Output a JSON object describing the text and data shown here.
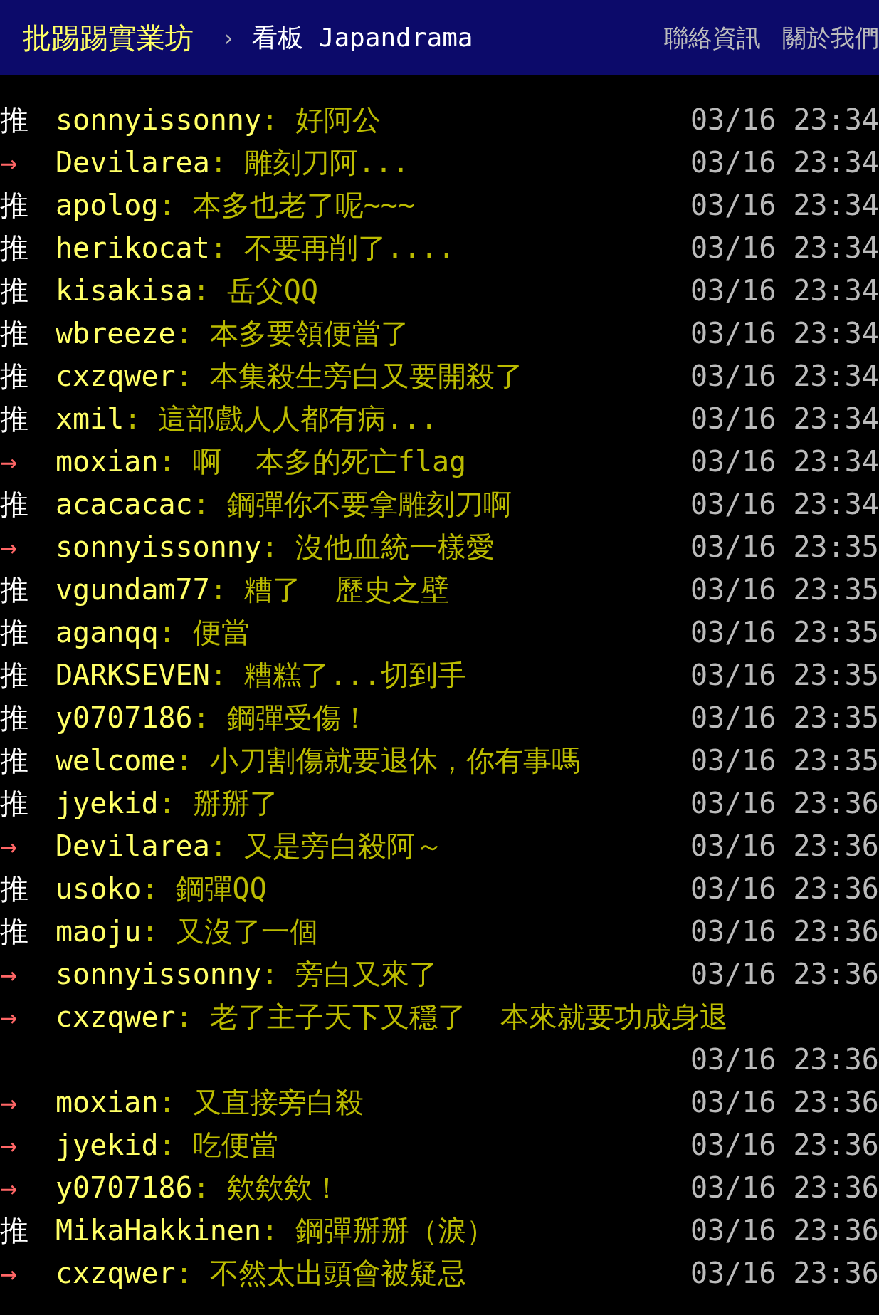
{
  "header": {
    "site_title": "批踢踢實業坊",
    "separator": "›",
    "board": "看板 Japandrama",
    "links": [
      "聯絡資訊",
      "關於我們"
    ]
  },
  "comments": [
    {
      "kind": "push",
      "tag": "推",
      "user": "sonnyissonny",
      "content": ": 好阿公",
      "time": "03/16 23:34"
    },
    {
      "kind": "arrow",
      "tag": "→",
      "user": "Devilarea",
      "content": ": 雕刻刀阿...",
      "time": "03/16 23:34"
    },
    {
      "kind": "push",
      "tag": "推",
      "user": "apolog",
      "content": ": 本多也老了呢~~~",
      "time": "03/16 23:34"
    },
    {
      "kind": "push",
      "tag": "推",
      "user": "herikocat",
      "content": ": 不要再削了....",
      "time": "03/16 23:34"
    },
    {
      "kind": "push",
      "tag": "推",
      "user": "kisakisa",
      "content": ": 岳父QQ",
      "time": "03/16 23:34"
    },
    {
      "kind": "push",
      "tag": "推",
      "user": "wbreeze",
      "content": ": 本多要領便當了",
      "time": "03/16 23:34"
    },
    {
      "kind": "push",
      "tag": "推",
      "user": "cxzqwer",
      "content": ": 本集殺生旁白又要開殺了",
      "time": "03/16 23:34"
    },
    {
      "kind": "push",
      "tag": "推",
      "user": "xmil",
      "content": ": 這部戲人人都有病...",
      "time": "03/16 23:34"
    },
    {
      "kind": "arrow",
      "tag": "→",
      "user": "moxian",
      "content": ": 啊  本多的死亡flag",
      "time": "03/16 23:34"
    },
    {
      "kind": "push",
      "tag": "推",
      "user": "acacacac",
      "content": ": 鋼彈你不要拿雕刻刀啊",
      "time": "03/16 23:34"
    },
    {
      "kind": "arrow",
      "tag": "→",
      "user": "sonnyissonny",
      "content": ": 沒他血統一樣愛",
      "time": "03/16 23:35"
    },
    {
      "kind": "push",
      "tag": "推",
      "user": "vgundam77",
      "content": ": 糟了  歷史之壁",
      "time": "03/16 23:35"
    },
    {
      "kind": "push",
      "tag": "推",
      "user": "aganqq",
      "content": ": 便當",
      "time": "03/16 23:35"
    },
    {
      "kind": "push",
      "tag": "推",
      "user": "DARKSEVEN",
      "content": ": 糟糕了...切到手",
      "time": "03/16 23:35"
    },
    {
      "kind": "push",
      "tag": "推",
      "user": "y0707186",
      "content": ": 鋼彈受傷！",
      "time": "03/16 23:35"
    },
    {
      "kind": "push",
      "tag": "推",
      "user": "welcome",
      "content": ": 小刀割傷就要退休，你有事嗎",
      "time": "03/16 23:35"
    },
    {
      "kind": "push",
      "tag": "推",
      "user": "jyekid",
      "content": ": 掰掰了",
      "time": "03/16 23:36"
    },
    {
      "kind": "arrow",
      "tag": "→",
      "user": "Devilarea",
      "content": ": 又是旁白殺阿～",
      "time": "03/16 23:36"
    },
    {
      "kind": "push",
      "tag": "推",
      "user": "usoko",
      "content": ": 鋼彈QQ",
      "time": "03/16 23:36"
    },
    {
      "kind": "push",
      "tag": "推",
      "user": "maoju",
      "content": ": 又沒了一個",
      "time": "03/16 23:36"
    },
    {
      "kind": "arrow",
      "tag": "→",
      "user": "sonnyissonny",
      "content": ": 旁白又來了",
      "time": "03/16 23:36"
    },
    {
      "kind": "arrow",
      "tag": "→",
      "user": "cxzqwer",
      "content": ": 老了主子天下又穩了  本來就要功成身退",
      "time": "03/16 23:36"
    },
    {
      "kind": "arrow",
      "tag": "→",
      "user": "moxian",
      "content": ": 又直接旁白殺",
      "time": "03/16 23:36"
    },
    {
      "kind": "arrow",
      "tag": "→",
      "user": "jyekid",
      "content": ": 吃便當",
      "time": "03/16 23:36"
    },
    {
      "kind": "arrow",
      "tag": "→",
      "user": "y0707186",
      "content": ": 欸欸欸！",
      "time": "03/16 23:36"
    },
    {
      "kind": "push",
      "tag": "推",
      "user": "MikaHakkinen",
      "content": ": 鋼彈掰掰（淚）",
      "time": "03/16 23:36"
    },
    {
      "kind": "arrow",
      "tag": "→",
      "user": "cxzqwer",
      "content": ": 不然太出頭會被疑忌",
      "time": "03/16 23:36"
    }
  ]
}
